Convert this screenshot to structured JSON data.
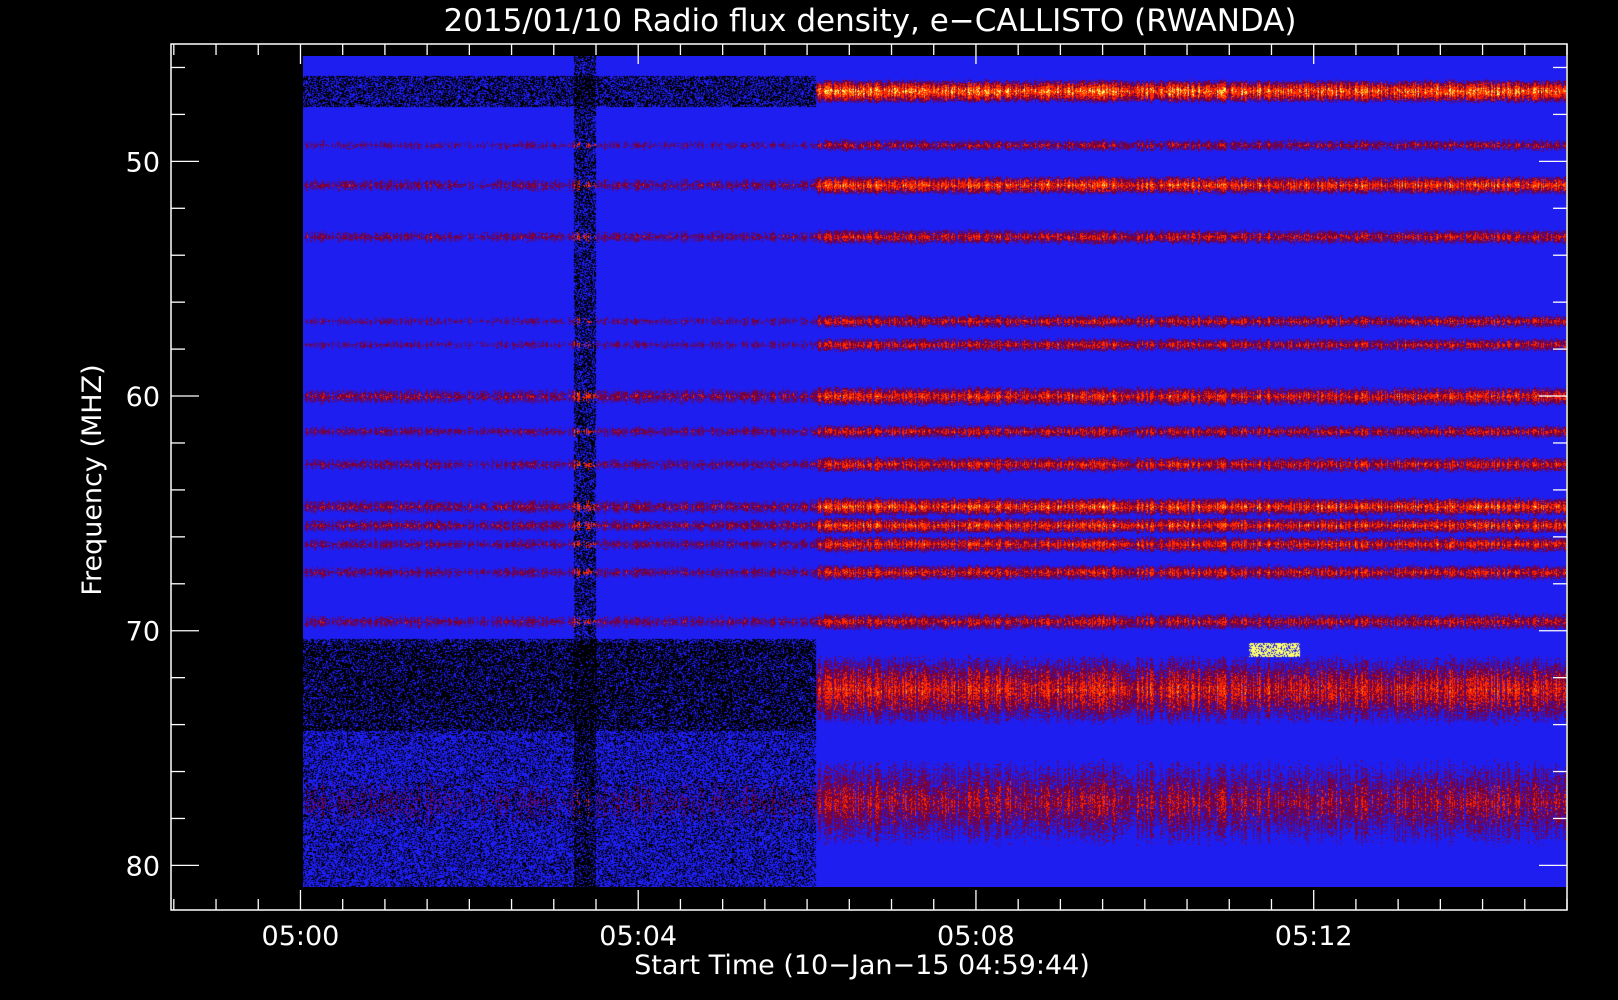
{
  "chart_data": {
    "type": "heatmap",
    "title": "2015/01/10  Radio flux density, e−CALLISTO (RWANDA)",
    "xlabel": "Start Time (10−Jan−15 04:59:44)",
    "ylabel": "Frequency (MHZ)",
    "x_unit": "time (UT, HH:MM)",
    "xlim": [
      "04:58:28",
      "05:15:00"
    ],
    "ylim": [
      81.9,
      45.0
    ],
    "data_extent": {
      "time_start": "05:00:02",
      "time_end": "05:14:59",
      "freq_min": 45.5,
      "freq_max": 80.9
    },
    "y_inverted": true,
    "x_ticks": [
      "05:00",
      "05:04",
      "05:08",
      "05:12"
    ],
    "y_ticks": [
      50,
      60,
      70,
      80
    ],
    "colormap": [
      "#000000",
      "#0000ff",
      "#ff2000",
      "#ffff66"
    ],
    "background_color": "#2020f0",
    "bands": [
      {
        "freq": 47.0,
        "width": 0.8,
        "intensity_before": 0.15,
        "intensity_after": 0.95
      },
      {
        "freq": 49.3,
        "width": 0.4,
        "intensity_before": 0.35,
        "intensity_after": 0.5
      },
      {
        "freq": 51.0,
        "width": 0.6,
        "intensity_before": 0.4,
        "intensity_after": 0.8
      },
      {
        "freq": 53.2,
        "width": 0.5,
        "intensity_before": 0.4,
        "intensity_after": 0.6
      },
      {
        "freq": 56.8,
        "width": 0.4,
        "intensity_before": 0.35,
        "intensity_after": 0.6
      },
      {
        "freq": 57.8,
        "width": 0.4,
        "intensity_before": 0.35,
        "intensity_after": 0.6
      },
      {
        "freq": 60.0,
        "width": 0.7,
        "intensity_before": 0.45,
        "intensity_after": 0.7
      },
      {
        "freq": 61.5,
        "width": 0.4,
        "intensity_before": 0.4,
        "intensity_after": 0.6
      },
      {
        "freq": 62.9,
        "width": 0.5,
        "intensity_before": 0.4,
        "intensity_after": 0.65
      },
      {
        "freq": 64.7,
        "width": 0.6,
        "intensity_before": 0.45,
        "intensity_after": 0.8
      },
      {
        "freq": 65.5,
        "width": 0.5,
        "intensity_before": 0.45,
        "intensity_after": 0.75
      },
      {
        "freq": 66.3,
        "width": 0.5,
        "intensity_before": 0.4,
        "intensity_after": 0.7
      },
      {
        "freq": 67.5,
        "width": 0.5,
        "intensity_before": 0.4,
        "intensity_after": 0.65
      },
      {
        "freq": 69.6,
        "width": 0.6,
        "intensity_before": 0.4,
        "intensity_after": 0.6
      },
      {
        "freq": 72.5,
        "width": 3.8,
        "intensity_before": 0.2,
        "intensity_after": 0.65
      },
      {
        "freq": 77.3,
        "width": 5.6,
        "intensity_before": 0.3,
        "intensity_after": 0.5
      }
    ],
    "events": [
      {
        "type": "vertical_stripe",
        "time_start": "05:03:14",
        "time_end": "05:03:30",
        "intensity": 0.85
      },
      {
        "type": "onset",
        "time": "05:06:06"
      },
      {
        "type": "burst",
        "time_start": "05:11:14",
        "time_end": "05:11:50",
        "freq": 70.8,
        "intensity": 1.0
      }
    ]
  }
}
